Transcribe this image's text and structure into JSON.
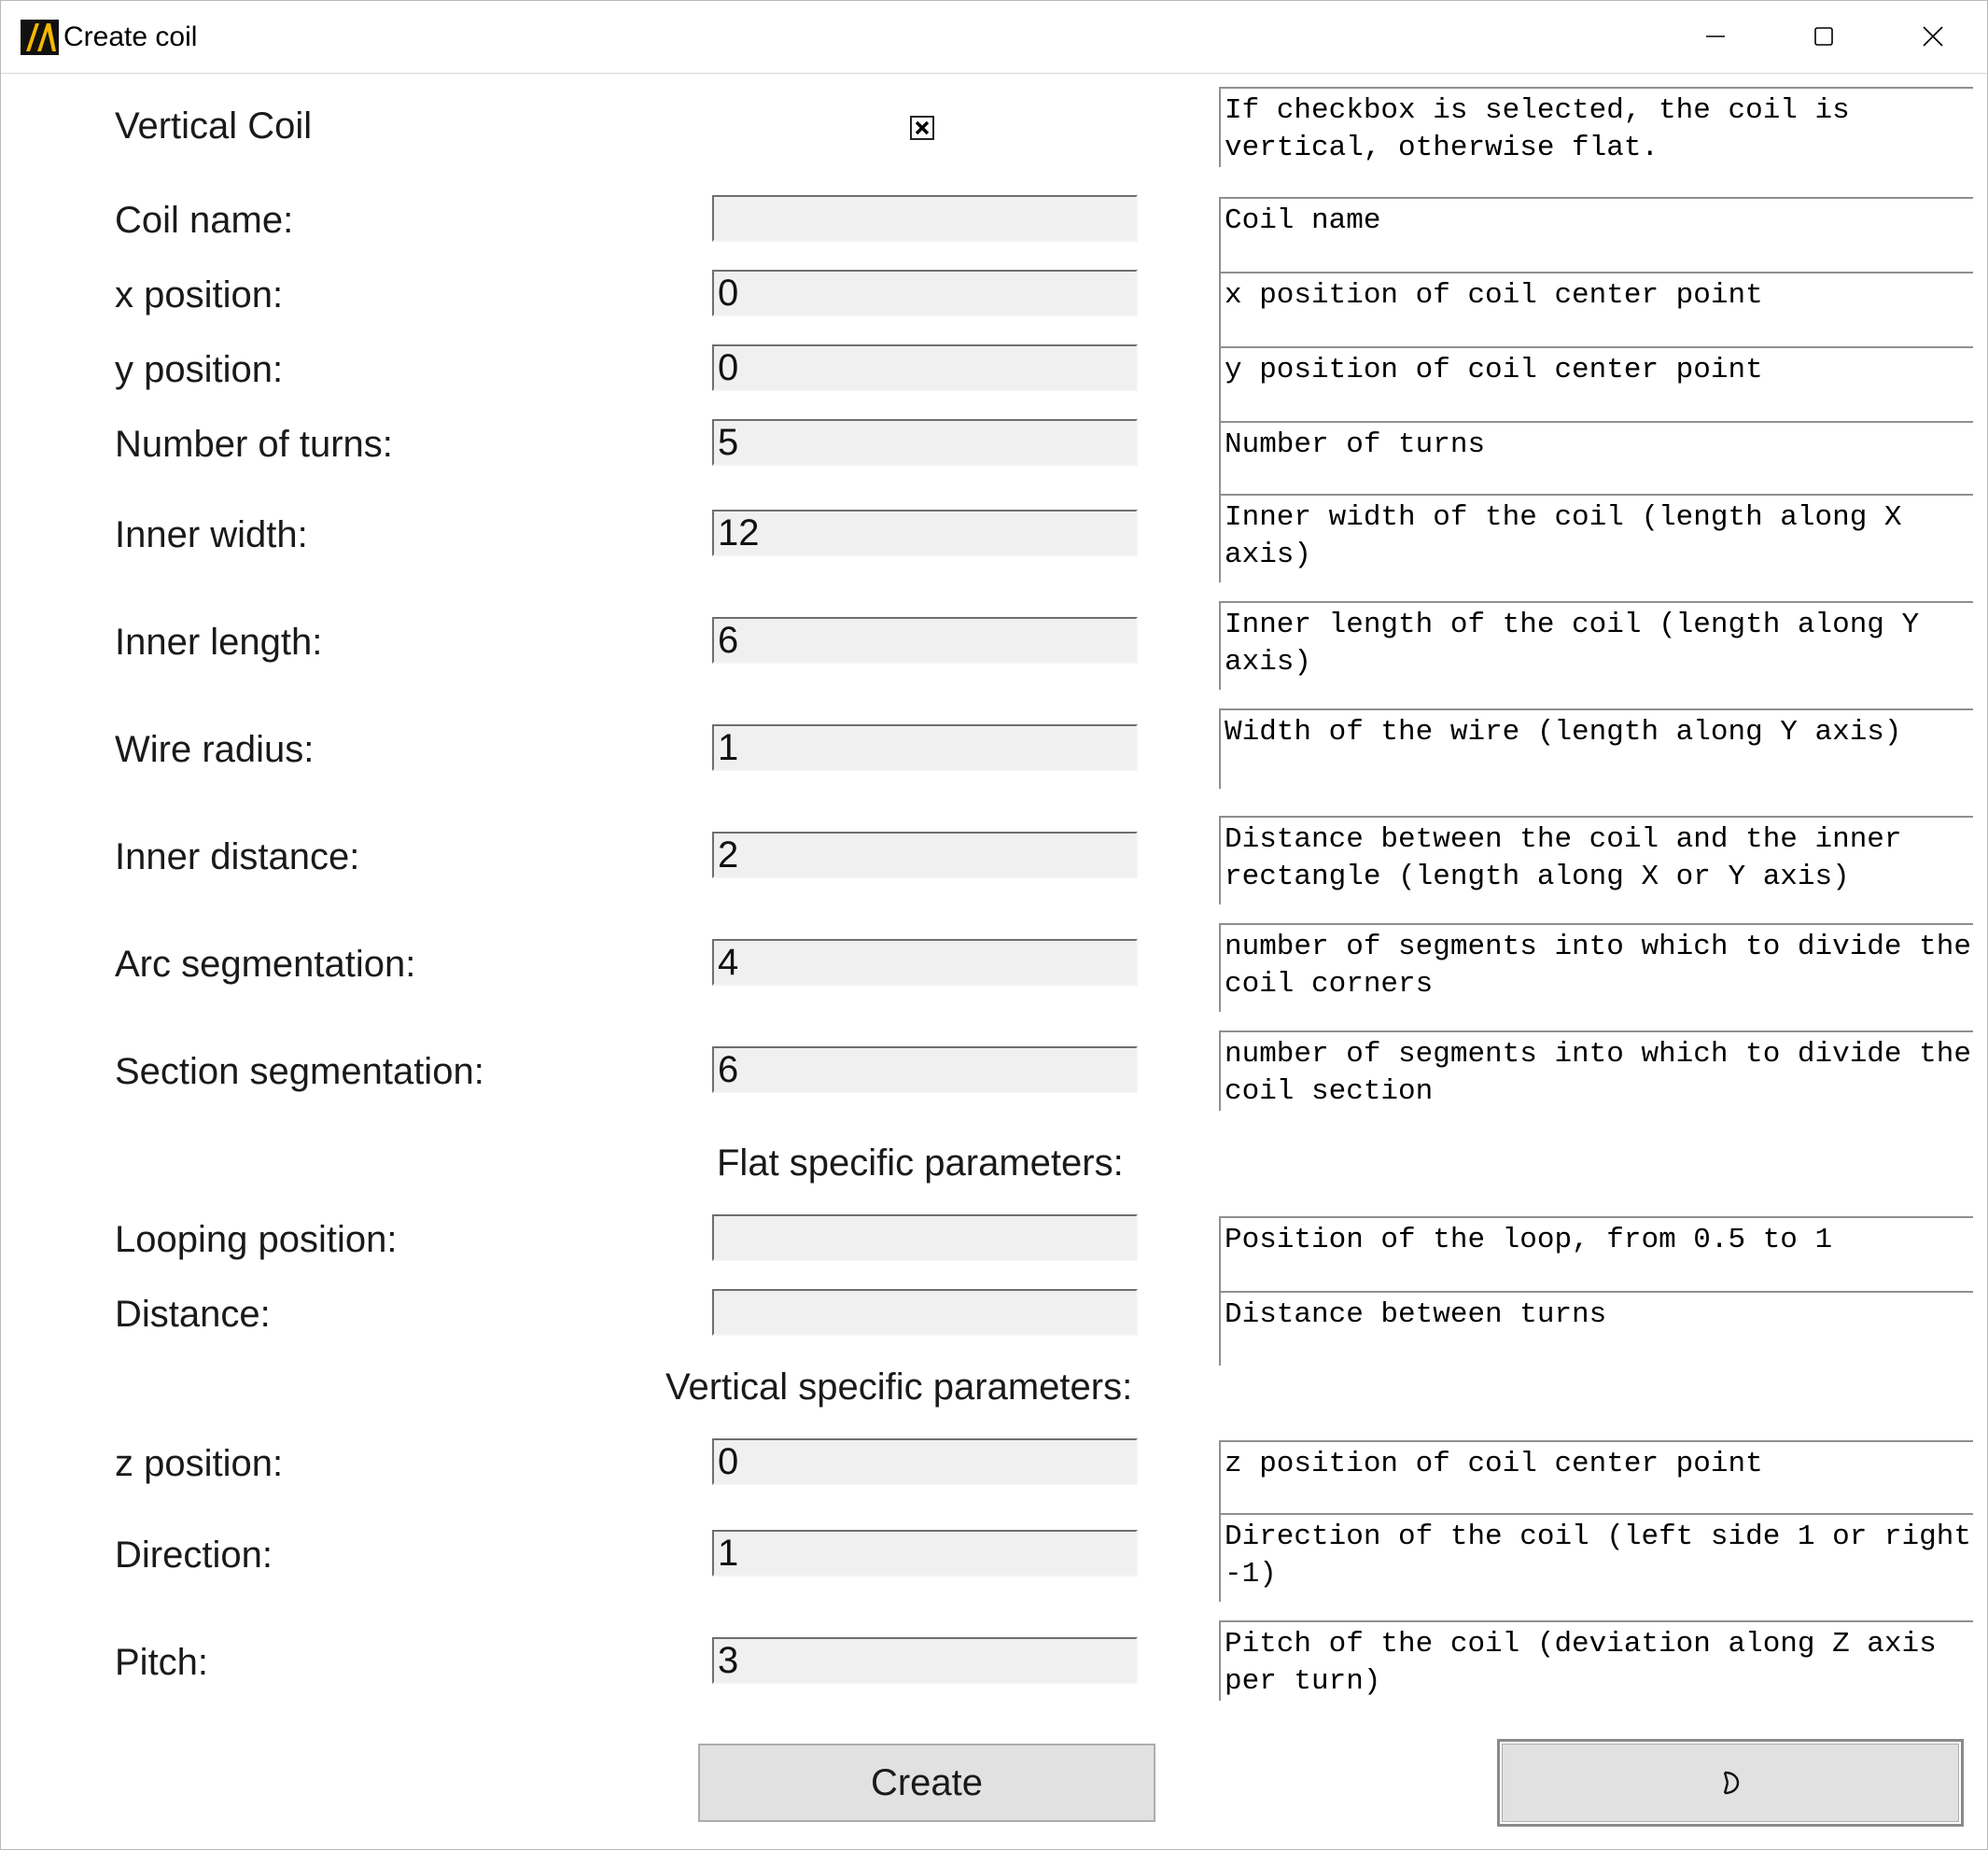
{
  "window": {
    "title": "Create coil",
    "controls": {
      "minimize_icon": "minimize-icon",
      "maximize_icon": "maximize-icon",
      "close_icon": "close-icon"
    }
  },
  "vertical_coil": {
    "label": "Vertical Coil",
    "checked": true,
    "description": "If checkbox is selected, the coil is vertical, otherwise flat."
  },
  "fields": {
    "coil_name": {
      "label": "Coil name:",
      "value": "",
      "description": "Coil name"
    },
    "x_position": {
      "label": "x position:",
      "value": "0",
      "description": "x position of coil center point"
    },
    "y_position": {
      "label": "y position:",
      "value": "0",
      "description": "y position of coil center point"
    },
    "number_of_turns": {
      "label": "Number of turns:",
      "value": "5",
      "description": "Number of turns"
    },
    "inner_width": {
      "label": "Inner width:",
      "value": "12",
      "description": "Inner width of the coil (length along X axis)"
    },
    "inner_length": {
      "label": "Inner length:",
      "value": "6",
      "description": "Inner length of the coil (length along Y axis)"
    },
    "wire_radius": {
      "label": "Wire radius:",
      "value": "1",
      "description": "Width of the wire (length along Y axis)"
    },
    "inner_distance": {
      "label": "Inner distance:",
      "value": "2",
      "description": "Distance between the coil and the inner rectangle (length along X or Y axis)"
    },
    "arc_segmentation": {
      "label": "Arc segmentation:",
      "value": "4",
      "description": "number of segments into which to divide the coil corners"
    },
    "section_segmentation": {
      "label": "Section segmentation:",
      "value": "6",
      "description": "number of segments into which to divide the coil section"
    }
  },
  "flat_section": {
    "heading": "Flat specific parameters:",
    "looping_position": {
      "label": "Looping position:",
      "value": "",
      "description": "Position of the loop, from 0.5 to 1"
    },
    "distance": {
      "label": "Distance:",
      "value": "",
      "description": "Distance between turns"
    }
  },
  "vertical_section": {
    "heading": "Vertical specific parameters:",
    "z_position": {
      "label": "z position:",
      "value": "0",
      "description": "z position of coil center point"
    },
    "direction": {
      "label": "Direction:",
      "value": "1",
      "description": "Direction of the coil (left side 1 or right -1)"
    },
    "pitch": {
      "label": "Pitch:",
      "value": "3",
      "description": "Pitch of the coil (deviation along Z axis per turn)"
    }
  },
  "buttons": {
    "create_label": "Create",
    "second_button_icon": "close-dialog-icon"
  }
}
